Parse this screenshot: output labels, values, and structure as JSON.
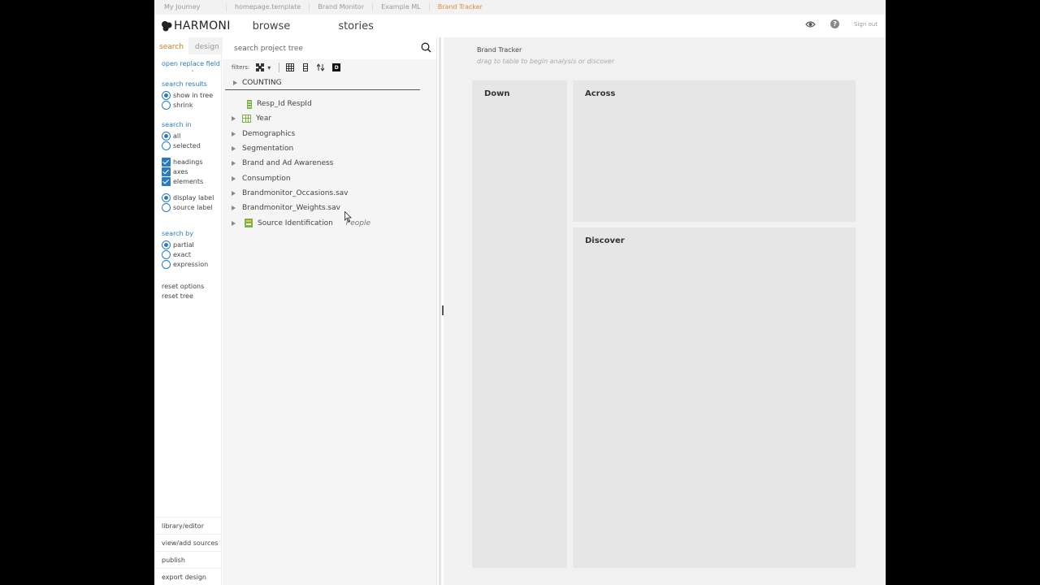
{
  "breadcrumbs": [
    "My Journey",
    "homepage.template",
    "Brand Monitor",
    "Example ML",
    "Brand Tracker"
  ],
  "header": {
    "logo": "HARMONI",
    "nav": [
      "browse",
      "stories"
    ],
    "sign_out": "Sign out",
    "help": "?"
  },
  "options": {
    "tabs": [
      "search",
      "design"
    ],
    "open_replace": "open replace field",
    "search_results": {
      "heading": "search results",
      "choices": [
        "show in tree",
        "shrink"
      ]
    },
    "search_in": {
      "heading": "search in",
      "choices": [
        "all",
        "selected"
      ],
      "checks": [
        "headings",
        "axes",
        "elements"
      ],
      "label_choices": [
        "display label",
        "source label"
      ]
    },
    "search_by": {
      "heading": "search by",
      "choices": [
        "partial",
        "exact",
        "expression"
      ]
    },
    "reset": [
      "reset options",
      "reset tree"
    ],
    "bottom_links": [
      "library/editor",
      "view/add sources",
      "publish",
      "export design"
    ]
  },
  "tree": {
    "search_placeholder": "search project tree",
    "filters_label": "filters:",
    "filter_badge": "D",
    "counting": "COUNTING",
    "rows": [
      {
        "label": "Resp_Id RespId",
        "icon": "variable-icon",
        "expandable": false
      },
      {
        "label": "Year",
        "icon": "grid-icon",
        "expandable": true
      },
      {
        "label": "Demographics",
        "expandable": true
      },
      {
        "label": "Segmentation",
        "expandable": true
      },
      {
        "label": "Brand and Ad Awareness",
        "expandable": true
      },
      {
        "label": "Consumption",
        "expandable": true
      },
      {
        "label": "Brandmonitor_Occasions.sav",
        "expandable": true
      },
      {
        "label": "Brandmonitor_Weights.sav",
        "expandable": true
      },
      {
        "label": "Source Identification",
        "icon": "source-icon",
        "expandable": true,
        "tag": "People"
      }
    ]
  },
  "canvas": {
    "title": "Brand Tracker",
    "subtitle": "drag to table to begin analysis or discover",
    "zones": {
      "down": "Down",
      "across": "Across",
      "discover": "Discover"
    }
  },
  "colors": {
    "accent": "#2b7bbf",
    "active_tab": "#d9791f",
    "green_icon": "#7cb342"
  }
}
